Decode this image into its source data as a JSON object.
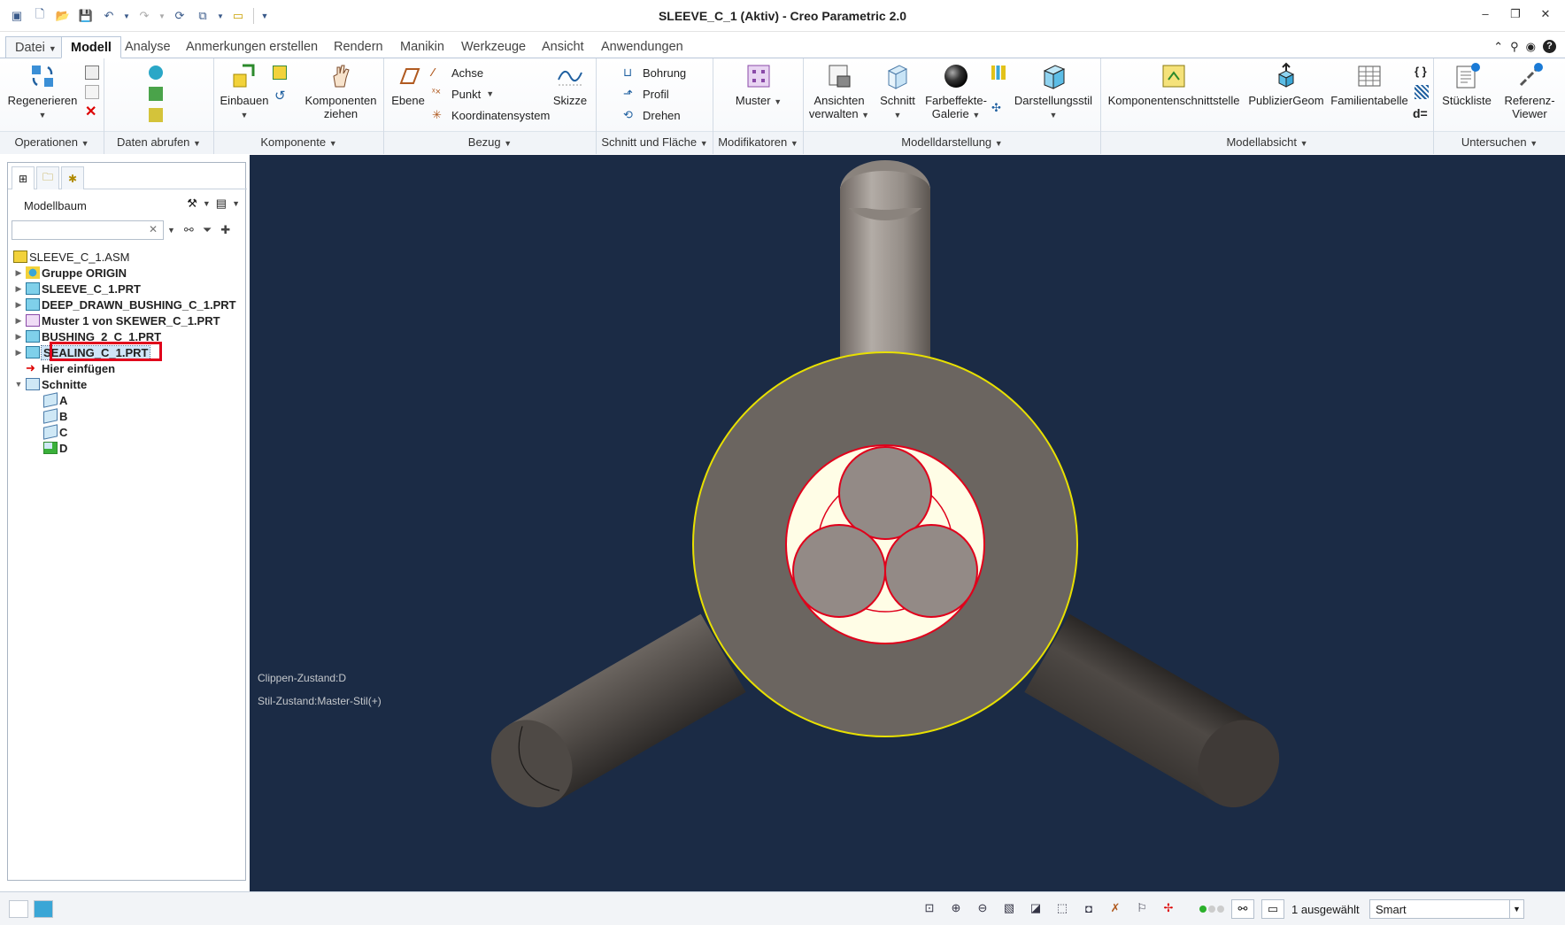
{
  "window": {
    "title": "SLEEVE_C_1 (Aktiv) - Creo Parametric 2.0"
  },
  "tabs": [
    {
      "label": "Datei",
      "active": false
    },
    {
      "label": "Modell",
      "active": true
    },
    {
      "label": "Analyse",
      "active": false
    },
    {
      "label": "Anmerkungen erstellen",
      "active": false
    },
    {
      "label": "Rendern",
      "active": false
    },
    {
      "label": "Manikin",
      "active": false
    },
    {
      "label": "Werkzeuge",
      "active": false
    },
    {
      "label": "Ansicht",
      "active": false
    },
    {
      "label": "Anwendungen",
      "active": false
    }
  ],
  "ribbon": {
    "operationen": {
      "label": "Operationen",
      "regenerieren": "Regenerieren"
    },
    "daten_abrufen": {
      "label": "Daten abrufen"
    },
    "komponente": {
      "label": "Komponente",
      "einbauen": "Einbauen",
      "komponenten_ziehen": "Komponenten ziehen"
    },
    "bezug": {
      "label": "Bezug",
      "ebene": "Ebene",
      "achse": "Achse",
      "punkt": "Punkt",
      "koordinatensystem": "Koordinatensystem",
      "skizze": "Skizze"
    },
    "schnitt_flaeche": {
      "label": "Schnitt und Fläche",
      "bohrung": "Bohrung",
      "profil": "Profil",
      "drehen": "Drehen"
    },
    "modifikatoren": {
      "label": "Modifikatoren",
      "muster": "Muster"
    },
    "modelldarstellung": {
      "label": "Modelldarstellung",
      "ansichten_verwalten": "Ansichten verwalten",
      "schnitt": "Schnitt",
      "farbeffekte": "Farbeffekte- Galerie",
      "darstellungsstil": "Darstellungsstil"
    },
    "modellabsicht": {
      "label": "Modellabsicht",
      "komponentenschnittstelle": "Komponentenschnittstelle",
      "publiziergeom": "PublizierGeom",
      "familientabelle": "Familientabelle",
      "d_eq": "d="
    },
    "untersuchen": {
      "label": "Untersuchen",
      "stueckliste": "Stückliste",
      "referenz_viewer": "Referenz- Viewer"
    }
  },
  "panel": {
    "title": "Modellbaum",
    "search": {
      "value": "",
      "placeholder": ""
    },
    "tree": [
      {
        "label": "SLEEVE_C_1.ASM",
        "level": 0,
        "expander": "",
        "icon": "assembly-icon"
      },
      {
        "label": "Gruppe ORIGIN",
        "level": 1,
        "expander": "▶",
        "icon": "group-icon"
      },
      {
        "label": "SLEEVE_C_1.PRT",
        "level": 1,
        "expander": "▶",
        "icon": "part-icon"
      },
      {
        "label": "DEEP_DRAWN_BUSHING_C_1.PRT",
        "level": 1,
        "expander": "▶",
        "icon": "part-icon"
      },
      {
        "label": "Muster 1 von SKEWER_C_1.PRT",
        "level": 1,
        "expander": "▶",
        "icon": "pattern-icon"
      },
      {
        "label": "BUSHING_2_C_1.PRT",
        "level": 1,
        "expander": "▶",
        "icon": "part-icon"
      },
      {
        "label": "SEALING_C_1.PRT",
        "level": 1,
        "expander": "▶",
        "icon": "part-icon",
        "selected": true
      },
      {
        "label": "Hier einfügen",
        "level": 1,
        "expander": "",
        "icon": "insert-arrow-icon"
      },
      {
        "label": "Schnitte",
        "level": 1,
        "expander": "▼",
        "icon": "folder-icon"
      },
      {
        "label": "A",
        "level": 2,
        "expander": "",
        "icon": "section-icon"
      },
      {
        "label": "B",
        "level": 2,
        "expander": "",
        "icon": "section-icon"
      },
      {
        "label": "C",
        "level": 2,
        "expander": "",
        "icon": "section-icon"
      },
      {
        "label": "D",
        "level": 2,
        "expander": "",
        "icon": "section-active-icon"
      }
    ]
  },
  "viewport": {
    "clip_state": "Clippen-Zustand:D",
    "style_state": "Stil-Zustand:Master-Stil(+)",
    "background": "#1b2b45"
  },
  "statusbar": {
    "selection": "1 ausgewählt",
    "filter": "Smart"
  },
  "colors": {
    "accent": "#2b5797",
    "highlight_red": "#e0001b",
    "sleeve": "#6b6560",
    "edge_yellow": "#e8e000",
    "sealing_fill": "#fffde6",
    "rod": "#8c8580"
  }
}
